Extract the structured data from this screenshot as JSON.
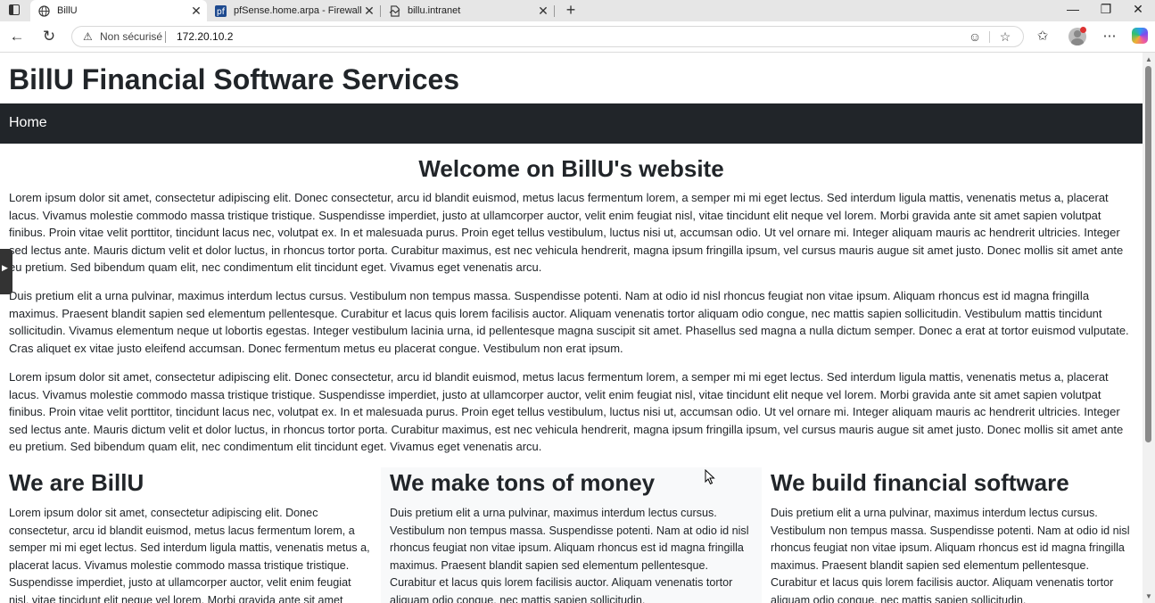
{
  "tabs": [
    {
      "title": "BillU",
      "favicon": "globe-icon",
      "active": true
    },
    {
      "title": "pfSense.home.arpa - Firewall: Rules",
      "favicon": "pfsense-icon",
      "active": false
    },
    {
      "title": "billu.intranet",
      "favicon": "broken-page-icon",
      "active": false
    }
  ],
  "addressbar": {
    "security_label": "Non sécurisé",
    "url": "172.20.10.2"
  },
  "page": {
    "site_title": "BillU Financial Software Services",
    "nav": {
      "home": "Home"
    },
    "welcome": "Welcome on BillU's website",
    "paragraphs": [
      "Lorem ipsum dolor sit amet, consectetur adipiscing elit. Donec consectetur, arcu id blandit euismod, metus lacus fermentum lorem, a semper mi mi eget lectus. Sed interdum ligula mattis, venenatis metus a, placerat lacus. Vivamus molestie commodo massa tristique tristique. Suspendisse imperdiet, justo at ullamcorper auctor, velit enim feugiat nisl, vitae tincidunt elit neque vel lorem. Morbi gravida ante sit amet sapien volutpat finibus. Proin vitae velit porttitor, tincidunt lacus nec, volutpat ex. In et malesuada purus. Proin eget tellus vestibulum, luctus nisi ut, accumsan odio. Ut vel ornare mi. Integer aliquam mauris ac hendrerit ultricies. Integer sed lectus ante. Mauris dictum velit et dolor luctus, in rhoncus tortor porta. Curabitur maximus, est nec vehicula hendrerit, magna ipsum fringilla ipsum, vel cursus mauris augue sit amet justo. Donec mollis sit amet ante eu pretium. Sed bibendum quam elit, nec condimentum elit tincidunt eget. Vivamus eget venenatis arcu.",
      "Duis pretium elit a urna pulvinar, maximus interdum lectus cursus. Vestibulum non tempus massa. Suspendisse potenti. Nam at odio id nisl rhoncus feugiat non vitae ipsum. Aliquam rhoncus est id magna fringilla maximus. Praesent blandit sapien sed elementum pellentesque. Curabitur et lacus quis lorem facilisis auctor. Aliquam venenatis tortor aliquam odio congue, nec mattis sapien sollicitudin. Vestibulum mattis tincidunt sollicitudin. Vivamus elementum neque ut lobortis egestas. Integer vestibulum lacinia urna, id pellentesque magna suscipit sit amet. Phasellus sed magna a nulla dictum semper. Donec a erat at tortor euismod vulputate. Cras aliquet ex vitae justo eleifend accumsan. Donec fermentum metus eu placerat congue. Vestibulum non erat ipsum.",
      "Lorem ipsum dolor sit amet, consectetur adipiscing elit. Donec consectetur, arcu id blandit euismod, metus lacus fermentum lorem, a semper mi mi eget lectus. Sed interdum ligula mattis, venenatis metus a, placerat lacus. Vivamus molestie commodo massa tristique tristique. Suspendisse imperdiet, justo at ullamcorper auctor, velit enim feugiat nisl, vitae tincidunt elit neque vel lorem. Morbi gravida ante sit amet sapien volutpat finibus. Proin vitae velit porttitor, tincidunt lacus nec, volutpat ex. In et malesuada purus. Proin eget tellus vestibulum, luctus nisi ut, accumsan odio. Ut vel ornare mi. Integer aliquam mauris ac hendrerit ultricies. Integer sed lectus ante. Mauris dictum velit et dolor luctus, in rhoncus tortor porta. Curabitur maximus, est nec vehicula hendrerit, magna ipsum fringilla ipsum, vel cursus mauris augue sit amet justo. Donec mollis sit amet ante eu pretium. Sed bibendum quam elit, nec condimentum elit tincidunt eget. Vivamus eget venenatis arcu."
    ],
    "columns": [
      {
        "heading": "We are BillU",
        "text": "Lorem ipsum dolor sit amet, consectetur adipiscing elit. Donec consectetur, arcu id blandit euismod, metus lacus fermentum lorem, a semper mi mi eget lectus. Sed interdum ligula mattis, venenatis metus a, placerat lacus. Vivamus molestie commodo massa tristique tristique. Suspendisse imperdiet, justo at ullamcorper auctor, velit enim feugiat nisl, vitae tincidunt elit neque vel lorem. Morbi gravida ante sit amet"
      },
      {
        "heading": "We make tons of money",
        "text": "Duis pretium elit a urna pulvinar, maximus interdum lectus cursus. Vestibulum non tempus massa. Suspendisse potenti. Nam at odio id nisl rhoncus feugiat non vitae ipsum. Aliquam rhoncus est id magna fringilla maximus. Praesent blandit sapien sed elementum pellentesque. Curabitur et lacus quis lorem facilisis auctor. Aliquam venenatis tortor aliquam odio congue, nec mattis sapien sollicitudin."
      },
      {
        "heading": "We build financial software",
        "text": "Duis pretium elit a urna pulvinar, maximus interdum lectus cursus. Vestibulum non tempus massa. Suspendisse potenti. Nam at odio id nisl rhoncus feugiat non vitae ipsum. Aliquam rhoncus est id magna fringilla maximus. Praesent blandit sapien sed elementum pellentesque. Curabitur et lacus quis lorem facilisis auctor. Aliquam venenatis tortor aliquam odio congue, nec mattis sapien sollicitudin."
      }
    ]
  },
  "colors": {
    "navbar": "#212529",
    "text": "#212529",
    "tabbar": "#e6e6e6"
  }
}
